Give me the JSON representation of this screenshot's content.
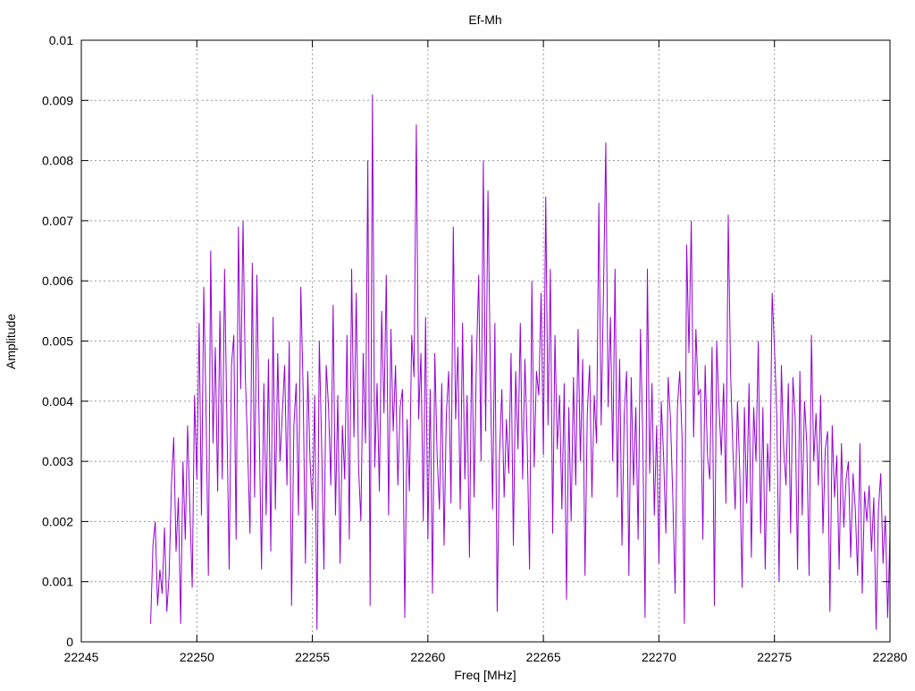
{
  "chart_data": {
    "type": "line",
    "title": "Ef-Mh",
    "xlabel": "Freq [MHz]",
    "ylabel": "Amplitude",
    "xlim": [
      22245,
      22280
    ],
    "ylim": [
      0,
      0.01
    ],
    "x_ticks": [
      22245,
      22250,
      22255,
      22260,
      22265,
      22270,
      22275,
      22280
    ],
    "x_tick_labels": [
      "22245",
      "22250",
      "22255",
      "22260",
      "22265",
      "22270",
      "22275",
      "22280"
    ],
    "y_ticks": [
      0,
      0.001,
      0.002,
      0.003,
      0.004,
      0.005,
      0.006,
      0.007,
      0.008,
      0.009,
      0.01
    ],
    "y_tick_labels": [
      "0",
      "0.001",
      "0.002",
      "0.003",
      "0.004",
      "0.005",
      "0.006",
      "0.007",
      "0.008",
      "0.009",
      "0.01"
    ],
    "grid": true,
    "legend": "none",
    "series": [
      {
        "color": "#9400d3",
        "x_start": 22248.0,
        "x_step": 0.1,
        "y": [
          0.0003,
          0.0016,
          0.002,
          0.0006,
          0.0012,
          0.0008,
          0.0019,
          0.0005,
          0.0011,
          0.0026,
          0.0034,
          0.0015,
          0.0024,
          0.0003,
          0.003,
          0.0017,
          0.0036,
          0.0022,
          0.0009,
          0.0041,
          0.0027,
          0.0053,
          0.0021,
          0.0059,
          0.0038,
          0.0011,
          0.0065,
          0.0033,
          0.0049,
          0.0025,
          0.0055,
          0.0027,
          0.0062,
          0.0037,
          0.0012,
          0.0046,
          0.0051,
          0.0017,
          0.0069,
          0.0042,
          0.007,
          0.0044,
          0.0032,
          0.0018,
          0.0063,
          0.0024,
          0.0061,
          0.0035,
          0.0012,
          0.0043,
          0.0021,
          0.0047,
          0.0015,
          0.0054,
          0.0022,
          0.0048,
          0.003,
          0.0038,
          0.0046,
          0.0026,
          0.005,
          0.0006,
          0.0036,
          0.0043,
          0.0021,
          0.0059,
          0.0042,
          0.0013,
          0.0045,
          0.003,
          0.0022,
          0.0041,
          0.0002,
          0.005,
          0.0033,
          0.0012,
          0.0046,
          0.0039,
          0.0026,
          0.0056,
          0.0021,
          0.0041,
          0.0013,
          0.0036,
          0.0027,
          0.0051,
          0.0017,
          0.0062,
          0.0034,
          0.0058,
          0.0029,
          0.002,
          0.0048,
          0.0033,
          0.008,
          0.0006,
          0.0091,
          0.0029,
          0.0043,
          0.0025,
          0.0055,
          0.0038,
          0.0061,
          0.0021,
          0.0052,
          0.0035,
          0.0046,
          0.0026,
          0.0039,
          0.0042,
          0.0004,
          0.0037,
          0.0025,
          0.0051,
          0.0044,
          0.0086,
          0.0037,
          0.0048,
          0.002,
          0.0054,
          0.0017,
          0.0042,
          0.0008,
          0.0048,
          0.0031,
          0.0022,
          0.0043,
          0.0016,
          0.0038,
          0.0045,
          0.0023,
          0.0069,
          0.0037,
          0.0049,
          0.0022,
          0.0053,
          0.0027,
          0.0041,
          0.0014,
          0.0051,
          0.0024,
          0.0047,
          0.0061,
          0.003,
          0.008,
          0.0035,
          0.0075,
          0.0046,
          0.0022,
          0.0053,
          0.0005,
          0.0031,
          0.0042,
          0.0024,
          0.0037,
          0.0028,
          0.0048,
          0.0016,
          0.0045,
          0.0032,
          0.0053,
          0.0027,
          0.0047,
          0.0033,
          0.0012,
          0.006,
          0.0029,
          0.0045,
          0.0041,
          0.0058,
          0.0031,
          0.0074,
          0.0036,
          0.0062,
          0.0018,
          0.0051,
          0.0032,
          0.0041,
          0.0022,
          0.0043,
          0.0007,
          0.0039,
          0.002,
          0.0044,
          0.0026,
          0.0052,
          0.003,
          0.0047,
          0.0011,
          0.0038,
          0.0046,
          0.0024,
          0.0041,
          0.0033,
          0.0073,
          0.0036,
          0.0058,
          0.0083,
          0.0039,
          0.0054,
          0.003,
          0.0062,
          0.0024,
          0.0047,
          0.0016,
          0.0038,
          0.0045,
          0.0011,
          0.0044,
          0.0026,
          0.0039,
          0.0017,
          0.0052,
          0.0034,
          0.0004,
          0.0062,
          0.0028,
          0.0043,
          0.0021,
          0.0036,
          0.0013,
          0.004,
          0.0031,
          0.0018,
          0.0044,
          0.0037,
          0.0024,
          0.0008,
          0.0039,
          0.0045,
          0.0034,
          0.0003,
          0.0066,
          0.0048,
          0.007,
          0.0034,
          0.0052,
          0.0041,
          0.0042,
          0.0017,
          0.0046,
          0.0031,
          0.0027,
          0.0049,
          0.0006,
          0.005,
          0.0039,
          0.0031,
          0.0043,
          0.0023,
          0.0071,
          0.0045,
          0.0032,
          0.0022,
          0.004,
          0.0028,
          0.0009,
          0.0039,
          0.0023,
          0.0043,
          0.0014,
          0.0039,
          0.003,
          0.005,
          0.0018,
          0.0039,
          0.0012,
          0.0033,
          0.0025,
          0.0058,
          0.0049,
          0.0038,
          0.001,
          0.0046,
          0.0032,
          0.0026,
          0.0043,
          0.0018,
          0.0044,
          0.0037,
          0.0012,
          0.0045,
          0.0021,
          0.004,
          0.0033,
          0.0011,
          0.0051,
          0.003,
          0.0038,
          0.0026,
          0.0041,
          0.0018,
          0.0032,
          0.0035,
          0.0005,
          0.0036,
          0.0024,
          0.0031,
          0.0012,
          0.0033,
          0.0019,
          0.0027,
          0.003,
          0.0014,
          0.0028,
          0.0022,
          0.0011,
          0.0033,
          0.0008,
          0.0025,
          0.002,
          0.0026,
          0.0015,
          0.0024,
          0.0002,
          0.0022,
          0.0028,
          0.0013,
          0.0021,
          0.0004,
          0.0018,
          0.0025,
          0.0009,
          0.0022,
          0.0006,
          0.0023,
          0.0016,
          0.001,
          0.002,
          0.0006,
          0.0015,
          0.0012,
          0.0015,
          0.0004,
          0.001
        ]
      }
    ]
  }
}
